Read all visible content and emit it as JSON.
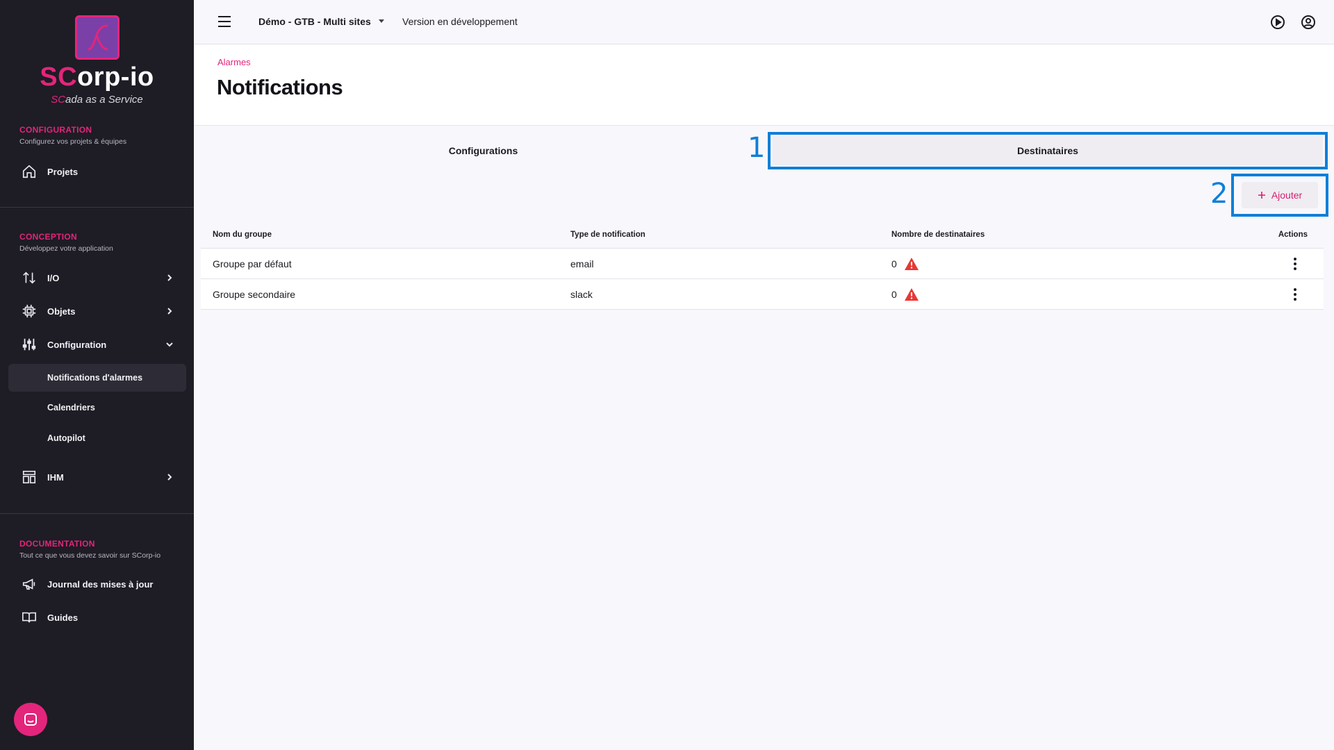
{
  "sidebar": {
    "logo": {
      "sc": "SC",
      "rest": "orp-io",
      "sub_sc": "SC",
      "sub_rest": "ada as a Service"
    },
    "sections": [
      {
        "title": "CONFIGURATION",
        "desc": "Configurez vos projets & équipes"
      },
      {
        "title": "CONCEPTION",
        "desc": "Développez votre application"
      },
      {
        "title": "DOCUMENTATION",
        "desc": "Tout ce que vous devez savoir sur SCorp-io"
      }
    ],
    "items": {
      "projets": "Projets",
      "io": "I/O",
      "objets": "Objets",
      "configuration": "Configuration",
      "notifications": "Notifications d'alarmes",
      "calendriers": "Calendriers",
      "autopilot": "Autopilot",
      "ihm": "IHM",
      "journal": "Journal des mises à jour",
      "guides": "Guides"
    }
  },
  "topbar": {
    "project": "Démo - GTB - Multi sites",
    "version": "Version en développement"
  },
  "header": {
    "breadcrumb": "Alarmes",
    "title": "Notifications"
  },
  "tabs": [
    {
      "label": "Configurations"
    },
    {
      "label": "Destinataires"
    }
  ],
  "annotations": [
    "1",
    "2"
  ],
  "add_button": {
    "label": "Ajouter"
  },
  "table": {
    "columns": [
      "Nom du groupe",
      "Type de notification",
      "Nombre de destinataires",
      "Actions"
    ],
    "rows": [
      {
        "name": "Groupe par défaut",
        "type": "email",
        "count": "0"
      },
      {
        "name": "Groupe secondaire",
        "type": "slack",
        "count": "0"
      }
    ]
  },
  "colors": {
    "accent": "#e3257b",
    "sidebar_bg": "#1e1c25",
    "highlight": "#0e7fd8",
    "warning": "#e53935"
  }
}
